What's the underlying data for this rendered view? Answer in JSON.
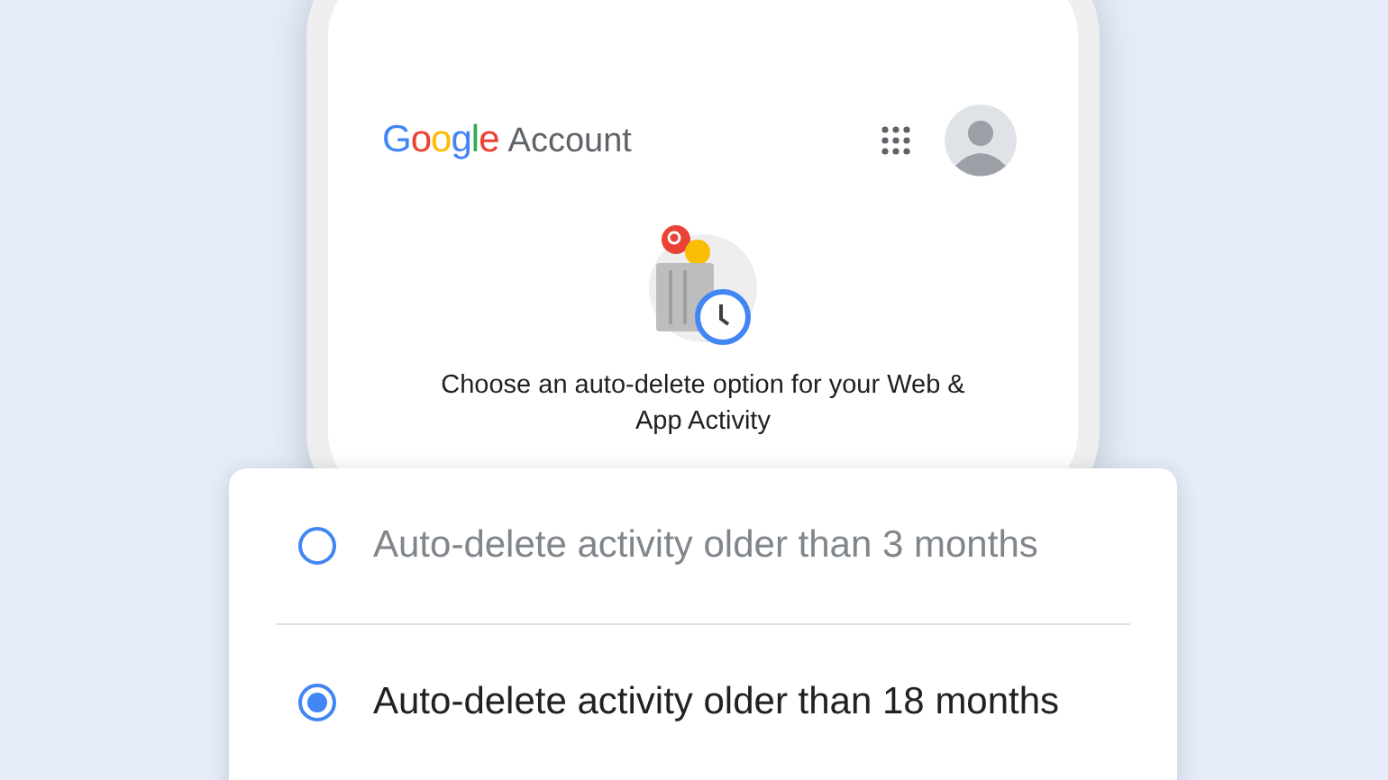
{
  "header": {
    "logo": "Google",
    "title": "Account"
  },
  "prompt": "Choose an auto-delete option for your Web & App Activity",
  "options": [
    {
      "label": "Auto-delete activity older than 3 months",
      "selected": false
    },
    {
      "label": "Auto-delete activity older than 18 months",
      "selected": true
    }
  ]
}
